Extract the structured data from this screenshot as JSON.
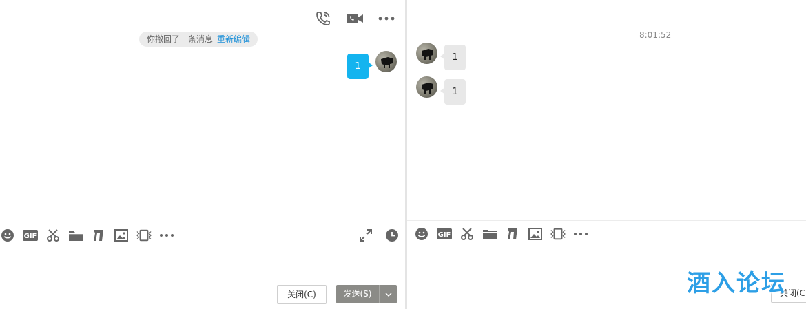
{
  "left_chat": {
    "header_icons": [
      "phone-call-icon",
      "video-call-icon",
      "more-icon"
    ],
    "recall_notice": {
      "text": "你撤回了一条消息",
      "action": "重新编辑"
    },
    "messages": [
      {
        "text": "1",
        "direction": "outgoing"
      }
    ],
    "toolbar": [
      "emoji-icon",
      "gif-icon",
      "scissors-icon",
      "folder-icon",
      "shake-icon",
      "image-icon",
      "screen-share-icon",
      "more-icon"
    ],
    "toolbar_right": [
      "expand-icon",
      "history-clock-icon"
    ],
    "close_label": "关闭(C)",
    "send_label": "发送(S)"
  },
  "right_chat": {
    "timestamp": "8:01:52",
    "messages": [
      {
        "text": "1",
        "direction": "incoming"
      },
      {
        "text": "1",
        "direction": "incoming"
      }
    ],
    "toolbar": [
      "emoji-icon",
      "gif-icon",
      "scissors-icon",
      "folder-icon",
      "shake-icon",
      "image-icon",
      "screen-share-icon",
      "more-icon"
    ],
    "close_label": "关闭(C",
    "watermark": "酒入论坛"
  },
  "colors": {
    "accent_blue": "#14b4ef",
    "link_blue": "#1a8fd8",
    "icon_gray": "#666666",
    "send_button": "#8b8b87",
    "watermark": "#2d9fe6"
  }
}
